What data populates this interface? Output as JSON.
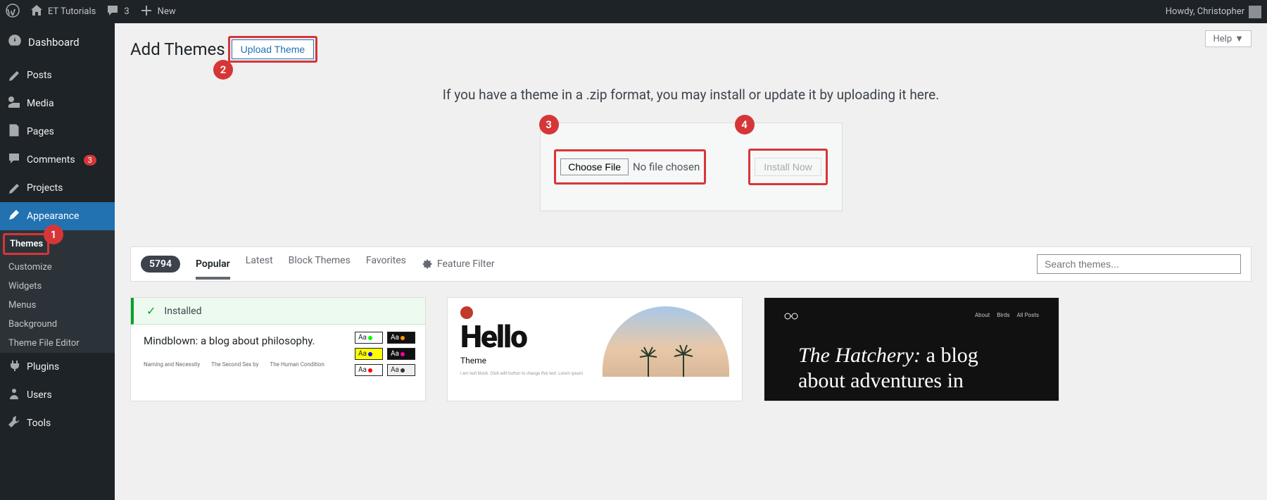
{
  "adminbar": {
    "site_name": "ET Tutorials",
    "comments_count": "3",
    "new_label": "New",
    "howdy": "Howdy, Christopher"
  },
  "sidebar": {
    "dashboard": "Dashboard",
    "items": [
      {
        "label": "Posts"
      },
      {
        "label": "Media"
      },
      {
        "label": "Pages"
      },
      {
        "label": "Comments",
        "count": "3"
      },
      {
        "label": "Projects"
      },
      {
        "label": "Appearance"
      },
      {
        "label": "Plugins"
      },
      {
        "label": "Users"
      },
      {
        "label": "Tools"
      }
    ],
    "submenu": [
      {
        "label": "Themes"
      },
      {
        "label": "Customize"
      },
      {
        "label": "Widgets"
      },
      {
        "label": "Menus"
      },
      {
        "label": "Background"
      },
      {
        "label": "Theme File Editor"
      }
    ]
  },
  "page": {
    "title": "Add Themes",
    "upload_button": "Upload Theme",
    "help": "Help",
    "instructions": "If you have a theme in a .zip format, you may install or update it by uploading it here.",
    "choose_file": "Choose File",
    "no_file": "No file chosen",
    "install_now": "Install Now"
  },
  "callouts": {
    "c1": "1",
    "c2": "2",
    "c3": "3",
    "c4": "4"
  },
  "filters": {
    "count": "5794",
    "tabs": [
      "Popular",
      "Latest",
      "Block Themes",
      "Favorites"
    ],
    "feature_filter": "Feature Filter",
    "search_placeholder": "Search themes..."
  },
  "themes": {
    "installed_label": "Installed",
    "theme1": {
      "tagline": "Mindblown: a blog about philosophy.",
      "col1": "Naming and Necessity",
      "col2": "The Second Sex by",
      "col3": "The Human Condition",
      "aa": "Aa"
    },
    "theme2": {
      "title": "Hello",
      "sub": "Theme",
      "lorem": "I am text block. Click edit button to change this text. Lorem ipsum"
    },
    "theme3": {
      "nav": [
        "About",
        "Birds",
        "All Posts"
      ],
      "title_italic": "The Hatchery:",
      "title_rest": " a blog about adventures in"
    }
  }
}
